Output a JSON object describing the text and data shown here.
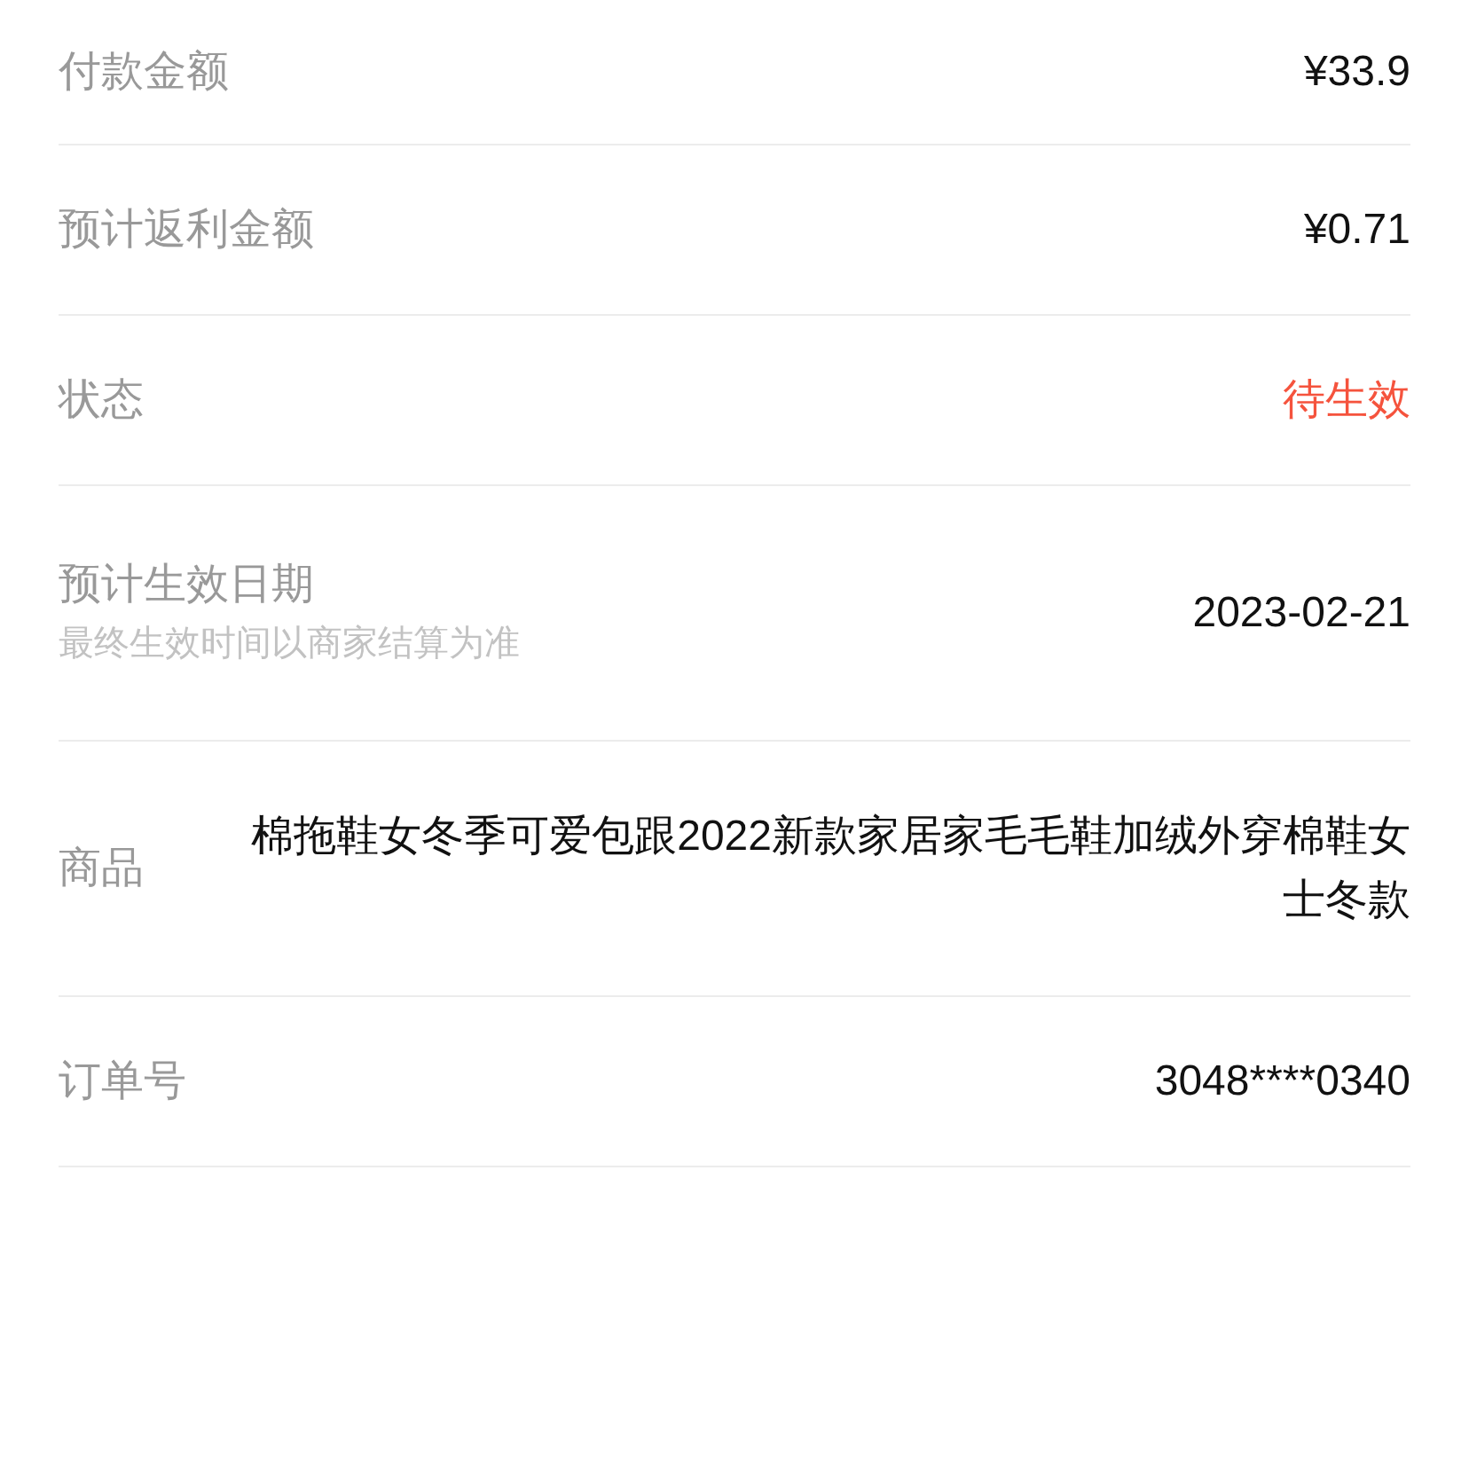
{
  "rows": [
    {
      "kind": "plain",
      "label": "付款金额",
      "value": "¥33.9"
    },
    {
      "kind": "plain",
      "label": "预计返利金额",
      "value": "¥0.71"
    },
    {
      "kind": "status",
      "label": "状态",
      "value": "待生效"
    },
    {
      "kind": "note",
      "label": "预计生效日期",
      "note": "最终生效时间以商家结算为准",
      "value": "2023-02-21"
    },
    {
      "kind": "plain",
      "label": "商品",
      "value": "棉拖鞋女冬季可爱包跟2022新款家居家毛毛鞋加绒外穿棉鞋女士冬款"
    },
    {
      "kind": "plain",
      "label": "订单号",
      "value": "3048****0340"
    }
  ]
}
